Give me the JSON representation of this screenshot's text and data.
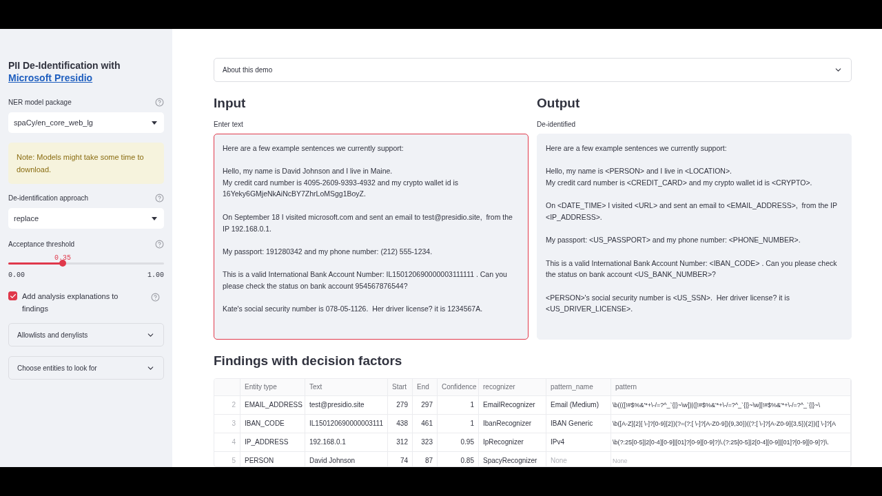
{
  "sidebar": {
    "title": "PII De-Identification with",
    "title_link": "Microsoft Presidio",
    "model_select": {
      "label": "NER model package",
      "value": "spaCy/en_core_web_lg"
    },
    "note": "Note: Models might take some time to download.",
    "approach_select": {
      "label": "De-identification approach",
      "value": "replace"
    },
    "threshold": {
      "label": "Acceptance threshold",
      "reading": "0.35",
      "min": "0.00",
      "max": "1.00",
      "level": 0.35
    },
    "explanations": {
      "label": "Add analysis explanations to findings",
      "checked": true
    },
    "expanders": [
      {
        "label": "Allowlists and denylists",
        "expanded": false
      },
      {
        "label": "Choose entities to look for",
        "expanded": false
      }
    ]
  },
  "about": {
    "label": "About this demo",
    "expanded": false
  },
  "input": {
    "heading": "Input",
    "label": "Enter text",
    "value": "Here are a few example sentences we currently support:\n\nHello, my name is David Johnson and I live in Maine.\nMy credit card number is 4095-2609-9393-4932 and my crypto wallet id is 16Yeky6GMjeNkAiNcBY7ZhrLoMSgg1BoyZ.\n\nOn September 18 I visited microsoft.com and sent an email to test@presidio.site,  from the IP 192.168.0.1.\n\nMy passport: 191280342 and my phone number: (212) 555-1234.\n\nThis is a valid International Bank Account Number: IL150120690000003111111 . Can you please check the status on bank account 954567876544?\n\nKate's social security number is 078-05-1126.  Her driver license? it is 1234567A."
  },
  "output": {
    "heading": "Output",
    "label": "De-identified",
    "value": "Here are a few example sentences we currently support:\n\nHello, my name is <PERSON> and I live in <LOCATION>.\nMy credit card number is <CREDIT_CARD> and my crypto wallet id is <CRYPTO>.\n\nOn <DATE_TIME> I visited <URL> and sent an email to <EMAIL_ADDRESS>,  from the IP <IP_ADDRESS>.\n\nMy passport: <US_PASSPORT> and my phone number: <PHONE_NUMBER>.\n\nThis is a valid International Bank Account Number: <IBAN_CODE> . Can you please check the status on bank account <US_BANK_NUMBER>?\n\n<PERSON>'s social security number is <US_SSN>.  Her driver license? it is <US_DRIVER_LICENSE>."
  },
  "findings": {
    "heading": "Findings with decision factors",
    "columns": [
      "Entity type",
      "Text",
      "Start",
      "End",
      "Confidence",
      "recognizer",
      "pattern_name",
      "pattern"
    ],
    "rows": [
      {
        "index": "2",
        "cells": [
          {
            "text": "EMAIL_ADDRESS",
            "missing": false
          },
          {
            "text": "test@presidio.site",
            "missing": false
          },
          {
            "text": "279",
            "missing": false
          },
          {
            "text": "297",
            "missing": false
          },
          {
            "text": "1",
            "missing": false
          },
          {
            "text": "EmailRecognizer",
            "missing": false
          },
          {
            "text": "Email (Medium)",
            "missing": false
          },
          {
            "text": "\\b((([!#$%&'*+\\-/=?^_`{|}~\\w])|([!#$%&'*+\\-/=?^_`{|}~\\w][!#$%&'*+\\-/=?^_`{|}~\\",
            "missing": false
          }
        ]
      },
      {
        "index": "3",
        "cells": [
          {
            "text": "IBAN_CODE",
            "missing": false
          },
          {
            "text": "IL150120690000003111",
            "missing": false
          },
          {
            "text": "438",
            "missing": false
          },
          {
            "text": "461",
            "missing": false
          },
          {
            "text": "1",
            "missing": false
          },
          {
            "text": "IbanRecognizer",
            "missing": false
          },
          {
            "text": "IBAN Generic",
            "missing": false
          },
          {
            "text": "\\b([A-Z]{2}[ \\-]?[0-9]{2})(?=(?:[ \\-]?[A-Z0-9]){9,30})((?:[ \\-]?[A-Z0-9]{3,5}){2})([ \\-]?[A",
            "missing": false
          }
        ]
      },
      {
        "index": "4",
        "cells": [
          {
            "text": "IP_ADDRESS",
            "missing": false
          },
          {
            "text": "192.168.0.1",
            "missing": false
          },
          {
            "text": "312",
            "missing": false
          },
          {
            "text": "323",
            "missing": false
          },
          {
            "text": "0.95",
            "missing": false
          },
          {
            "text": "IpRecognizer",
            "missing": false
          },
          {
            "text": "IPv4",
            "missing": false
          },
          {
            "text": "\\b(?:25[0-5]|2[0-4][0-9]|[01]?[0-9][0-9]?)\\.(?:25[0-5]|2[0-4][0-9]|[01]?[0-9][0-9]?)\\.",
            "missing": false
          }
        ]
      },
      {
        "index": "5",
        "cells": [
          {
            "text": "PERSON",
            "missing": false
          },
          {
            "text": "David Johnson",
            "missing": false
          },
          {
            "text": "74",
            "missing": false
          },
          {
            "text": "87",
            "missing": false
          },
          {
            "text": "0.85",
            "missing": false
          },
          {
            "text": "SpacyRecognizer",
            "missing": false
          },
          {
            "text": "None",
            "missing": true
          },
          {
            "text": "None",
            "missing": true
          }
        ]
      }
    ]
  }
}
